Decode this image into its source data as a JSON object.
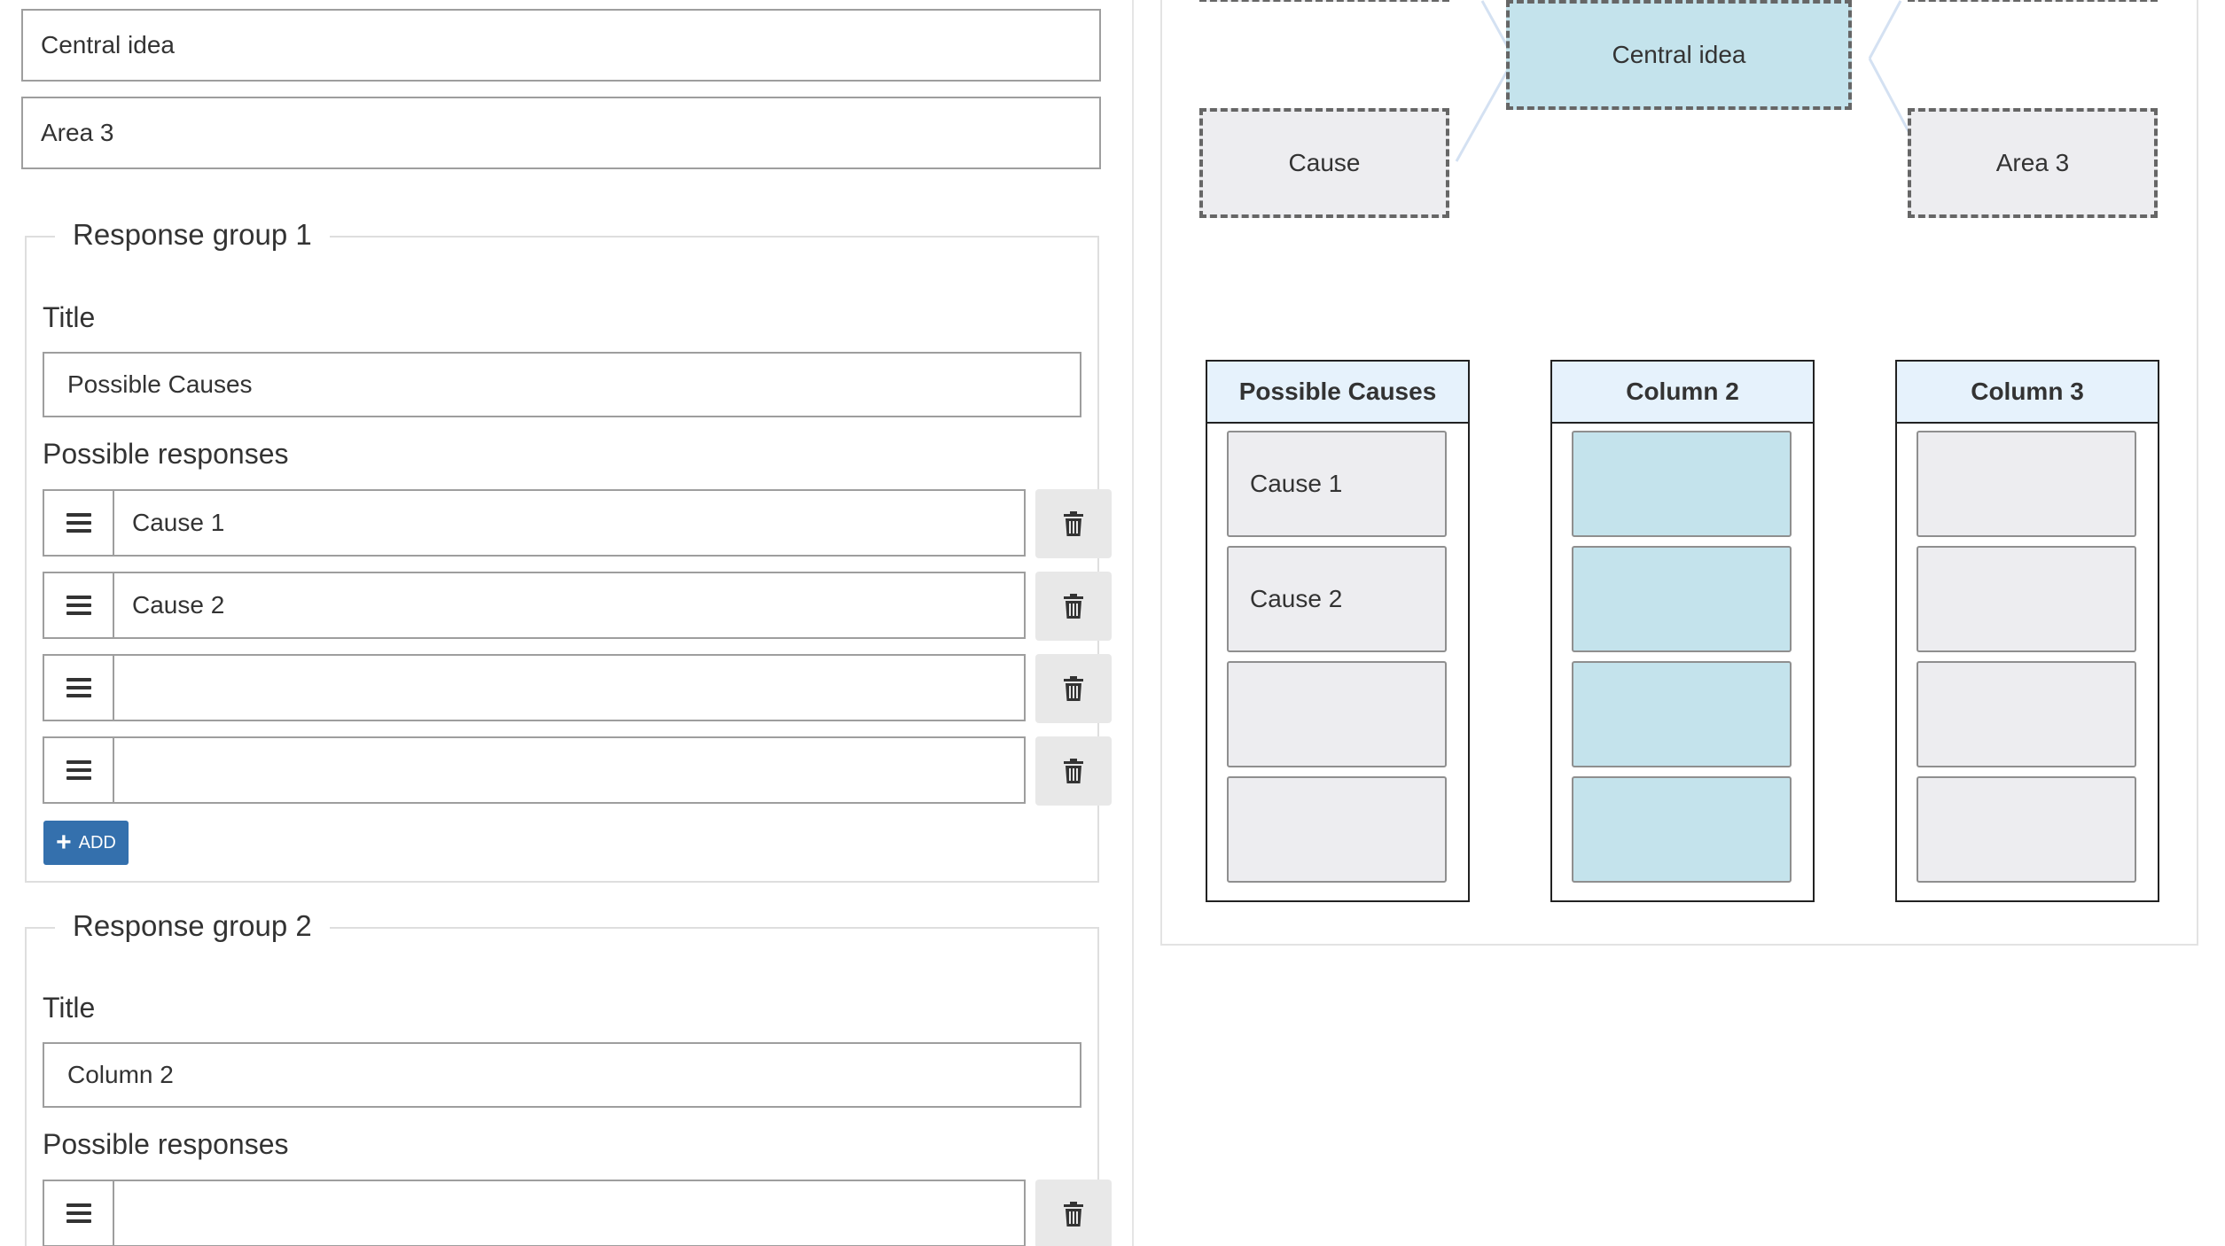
{
  "editor": {
    "central_idea_field": "Central idea",
    "area3_field": "Area 3",
    "groups": [
      {
        "legend": "Response group 1",
        "title_label": "Title",
        "title_value": "Possible Causes",
        "responses_label": "Possible responses",
        "responses": [
          "Cause 1",
          "Cause 2",
          "",
          ""
        ],
        "add_label": "ADD"
      },
      {
        "legend": "Response group 2",
        "title_label": "Title",
        "title_value": "Column 2",
        "responses_label": "Possible responses",
        "responses": [
          ""
        ]
      }
    ]
  },
  "icons": {
    "drag": "drag-handle-icon",
    "trash": "trash-icon",
    "plus": "plus-icon"
  },
  "preview": {
    "nodes": {
      "center": "Central idea",
      "cause": "Cause",
      "area3": "Area 3"
    },
    "columns": [
      {
        "header": "Possible Causes",
        "cells": [
          "Cause 1",
          "Cause 2",
          "",
          ""
        ]
      },
      {
        "header": "Column 2",
        "cells": [
          "",
          "",
          "",
          ""
        ]
      },
      {
        "header": "Column 3",
        "cells": [
          "",
          "",
          "",
          ""
        ]
      }
    ]
  },
  "colors": {
    "accent_button": "#3470ad",
    "center_fill": "#c4e3ec",
    "node_fill": "#ededf0",
    "header_fill": "#e6f2fc"
  }
}
